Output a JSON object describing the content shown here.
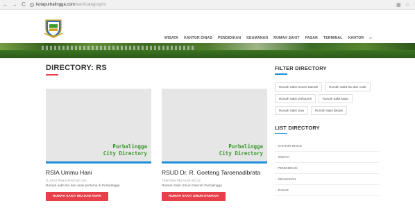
{
  "browser": {
    "url_host": "kotapurbalingga.com",
    "url_path": "/start/category/rs"
  },
  "menu": [
    "WISATA",
    "KANTOR DINAS",
    "PENDIDIKAN",
    "KEAMANAN",
    "RUMAH SAKIT",
    "PASAR",
    "TERMINAL",
    "KANTOR"
  ],
  "main": {
    "title": "DIRECTORY: RS",
    "cards": [
      {
        "brand_line1": "Purbalingga",
        "brand_line2": "City Directory",
        "title": "RSIA Ummu Hani",
        "address": "Jl.KOLI PANJAITAN NO.12A",
        "desc": "Rumah sakit ibu dan anak pertama di Purbalingga",
        "button": "RUMAH SAKIT IBU DAN ANAK"
      },
      {
        "brand_line1": "Purbalingga",
        "brand_line2": "City Directory",
        "title": "RSUD Dr. R. Goeteng Taroenadibrata",
        "address": "TENTARA PELAJAR NO.22",
        "desc": "Rumah Sakit Umum Daerah Purbalingga",
        "button": "RUMAH SAKIT UMUM DAERAH"
      }
    ]
  },
  "sidebar": {
    "filter_title": "FILTER DIRECTORY",
    "tags": [
      "Rumah Sakit Umum Daerah",
      "Rumah Sakit Ibu dan Anak",
      "Rumah Sakit Orthopedi",
      "Rumah Sakit Mata",
      "Rumah Sakit Jiwa",
      "Rumah Sakit Bedah"
    ],
    "list_title": "LIST DIRECTORY",
    "list": [
      "KANTOR DINAS",
      "WISATA",
      "PENDIDIKAN",
      "KEAMANAN",
      "PASAR"
    ]
  },
  "colors": {
    "accent_red": "#e8404b",
    "accent_blue": "#1e8fd8",
    "brand_green": "#3a9a2c"
  }
}
